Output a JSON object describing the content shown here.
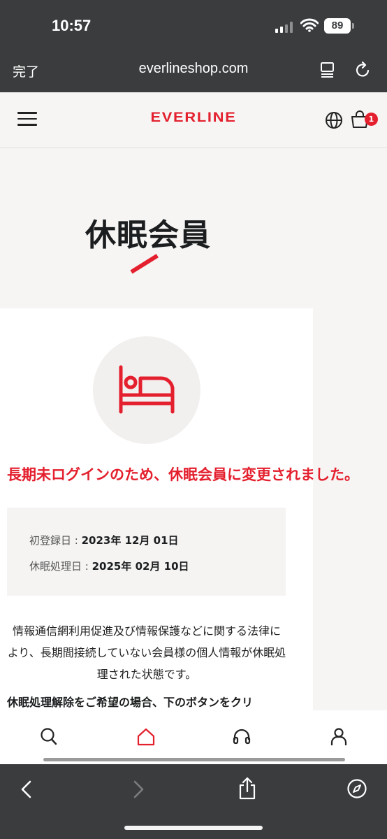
{
  "status": {
    "time": "10:57",
    "battery": "89"
  },
  "browser": {
    "done_label": "完了",
    "url": "everlineshop.com"
  },
  "site": {
    "logo": "EVERLINE",
    "cart_count": "1"
  },
  "page": {
    "title": "休眠会員",
    "headline": "長期未ログインのため、休眠会員に変更されました。",
    "registered_label": "初登録日 : ",
    "registered_value": "2023年 12月 01日",
    "dormant_label": "休眠処理日 : ",
    "dormant_value": "2025年 02月 10日",
    "description": "情報通信網利用促進及び情報保護などに関する法律により、長期間接続していない会員様の個人情報が休眠処理された状態です。",
    "instruction": "休眠処理解除をご希望の場合、下のボタンをクリ"
  },
  "colors": {
    "accent": "#e4202e",
    "chrome": "#3a3c3e"
  },
  "icons": [
    "menu-icon",
    "globe-icon",
    "cart-icon",
    "bed-icon",
    "search-icon",
    "home-icon",
    "headset-icon",
    "person-icon",
    "back-icon",
    "forward-icon",
    "share-icon",
    "compass-icon"
  ]
}
